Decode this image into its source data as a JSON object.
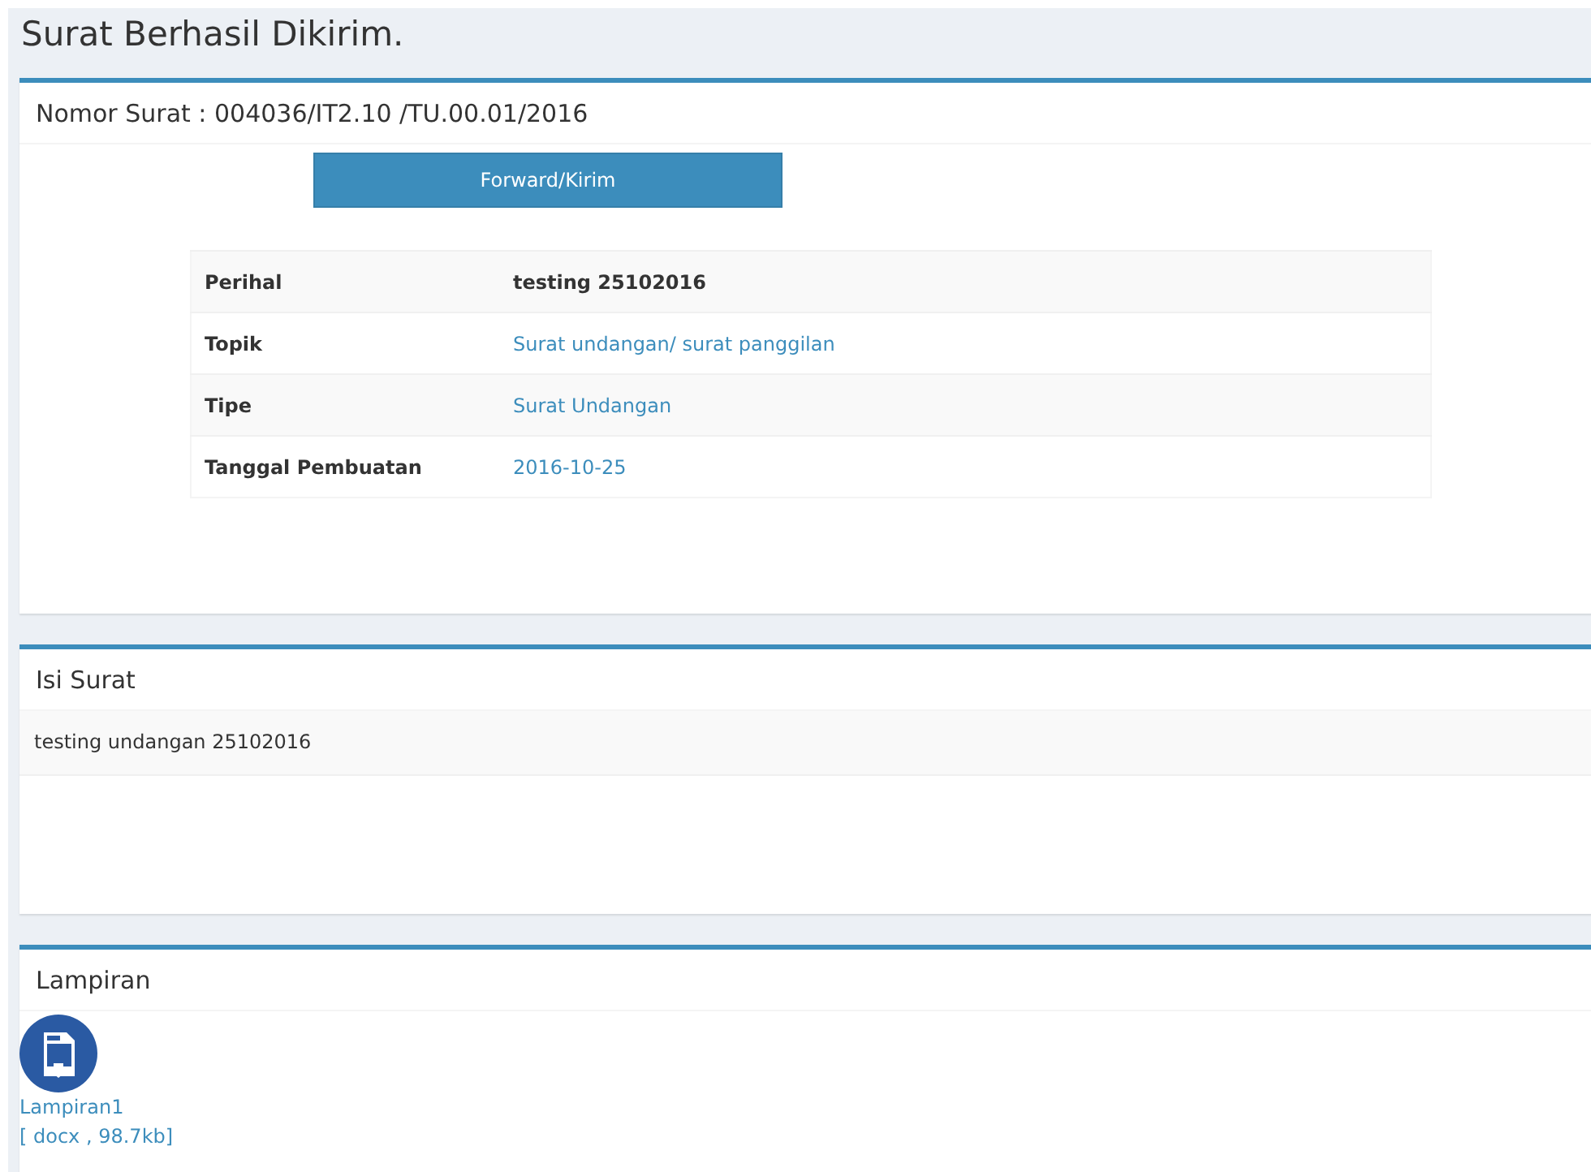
{
  "page_title": "Surat Berhasil Dikirim.",
  "letter_panel": {
    "title": "Nomor Surat : 004036/IT2.10 /TU.00.01/2016",
    "forward_button": "Forward/Kirim",
    "details": [
      {
        "label": "Perihal",
        "value": "testing 25102016",
        "kind": "bold"
      },
      {
        "label": "Topik",
        "value": "Surat undangan/ surat panggilan",
        "kind": "link"
      },
      {
        "label": "Tipe",
        "value": "Surat Undangan",
        "kind": "link"
      },
      {
        "label": "Tanggal Pembuatan",
        "value": "2016-10-25",
        "kind": "link"
      }
    ]
  },
  "content_panel": {
    "title": "Isi Surat",
    "body": "testing undangan 25102016"
  },
  "attachments_panel": {
    "title": "Lampiran",
    "files": [
      {
        "name": "Lampiran1",
        "info": "[ docx , 98.7kb]"
      }
    ]
  }
}
